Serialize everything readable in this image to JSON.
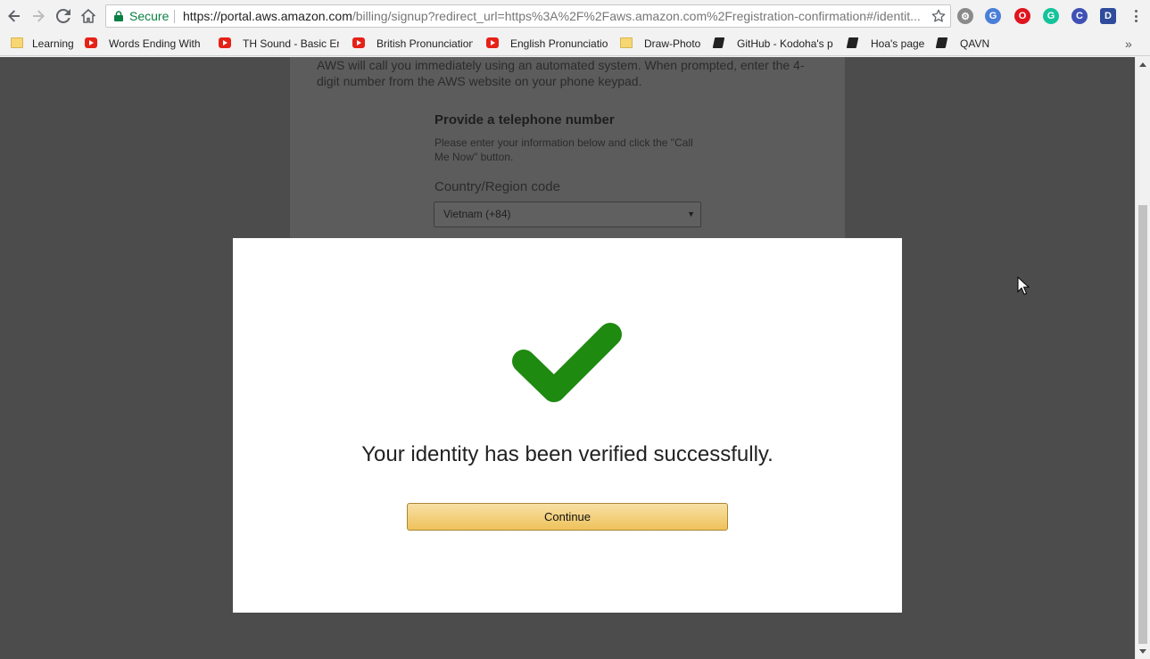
{
  "browser": {
    "omnibox": {
      "secure_label": "Secure",
      "url_host": "https://portal.aws.amazon.com",
      "url_path": "/billing/signup?redirect_url=https%3A%2F%2Faws.amazon.com%2Fregistration-confirmation#/identit..."
    },
    "bookmarks": [
      {
        "label": "Learning",
        "icon": "folder-icon"
      },
      {
        "label": "Words Ending With ",
        "icon": "youtube-icon"
      },
      {
        "label": "TH Sound - Basic En",
        "icon": "youtube-icon"
      },
      {
        "label": "British Pronunciation",
        "icon": "youtube-icon"
      },
      {
        "label": "English Pronunciatio",
        "icon": "youtube-icon"
      },
      {
        "label": "Draw-Photo",
        "icon": "folder-icon"
      },
      {
        "label": "GitHub - Kodoha's p",
        "icon": "book-icon"
      },
      {
        "label": "Hoa's page",
        "icon": "book-icon"
      },
      {
        "label": "QAVN",
        "icon": "book-icon"
      }
    ],
    "extensions": [
      {
        "name": "settings-extension-icon",
        "glyph": "⚙",
        "color": "#8a8a8a"
      },
      {
        "name": "google-translate-icon",
        "glyph": "G",
        "color": "#4a7fd8"
      },
      {
        "name": "opera-icon",
        "glyph": "O",
        "color": "#e0141e"
      },
      {
        "name": "grammarly-icon",
        "glyph": "G",
        "color": "#15c39a"
      },
      {
        "name": "extension-c-icon",
        "glyph": "C",
        "color": "#3f51b5"
      },
      {
        "name": "extension-d-icon",
        "glyph": "D",
        "color": "#2f4b9c"
      }
    ]
  },
  "page": {
    "intro_text": "AWS will call you immediately using an automated system. When prompted, enter the 4-digit number from the AWS website on your phone keypad.",
    "provide_phone_title": "Provide a telephone number",
    "provide_phone_desc": "Please enter your information below and click the \"Call Me Now\" button.",
    "country_label": "Country/Region code",
    "country_value": "Vietnam (+84)"
  },
  "modal": {
    "check_color": "#1e8a10",
    "success_message": "Your identity has been verified successfully.",
    "continue_label": "Continue"
  }
}
